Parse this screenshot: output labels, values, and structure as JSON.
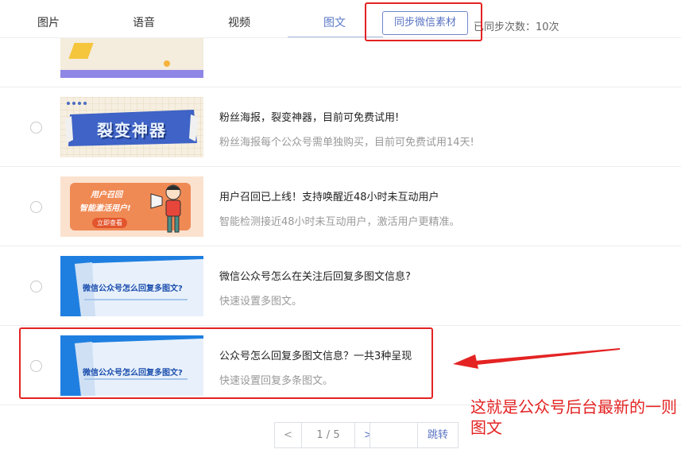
{
  "tabs": [
    {
      "label": "图片"
    },
    {
      "label": "语音"
    },
    {
      "label": "视频"
    },
    {
      "label": "图文"
    }
  ],
  "sync_button": "同步微信素材",
  "sync_count": "已同步次数：10次",
  "articles": [
    {
      "title": "粉丝海报，裂变神器，目前可免费试用!",
      "desc": "粉丝海报每个公众号需单独购买，目前可免费试用14天!",
      "thumb_text": "裂变神器"
    },
    {
      "title": "用户召回已上线！支持唤醒近48小时未互动用户",
      "desc": "智能检测接近48小时未互动用户，激活用户更精准。",
      "thumb_text_1": "用户召回",
      "thumb_text_2": "智能激活用户!",
      "thumb_text_3": "立即查看"
    },
    {
      "title": "微信公众号怎么在关注后回复多图文信息?",
      "desc": "快速设置多图文。",
      "thumb_text": "微信公众号怎么回复多图文?"
    },
    {
      "title": "公众号怎么回复多图文信息？一共3种呈现",
      "desc": "快速设置回复多条图文。",
      "thumb_text": "微信公众号怎么回复多图文?"
    }
  ],
  "pagination": {
    "prev": "<",
    "info": "1 / 5",
    "next": ">",
    "jump_value": "",
    "jump": "跳转"
  },
  "annotation": "这就是公众号后台最新的一则图文",
  "colors": {
    "accent": "#5b74c4",
    "annotation": "#e42323"
  }
}
